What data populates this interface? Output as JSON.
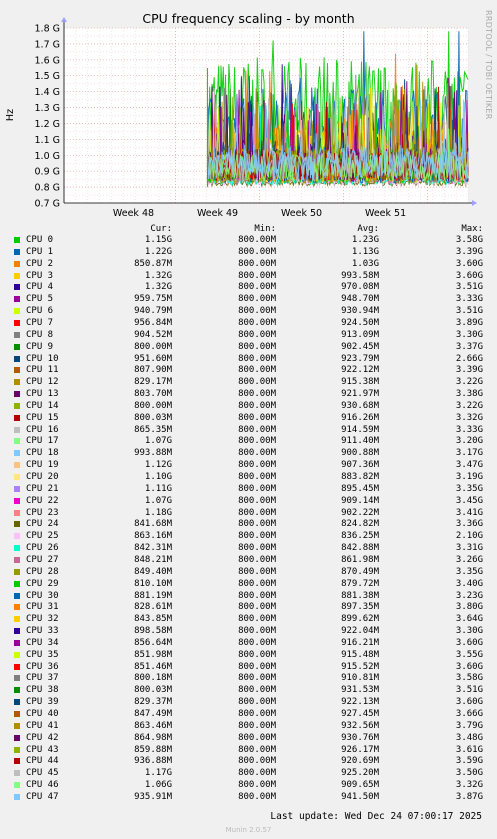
{
  "chart_data": {
    "type": "area",
    "title": "CPU frequency scaling - by month",
    "ylabel": "Hz",
    "y_ticks": [
      "0.7 G",
      "0.8 G",
      "0.9 G",
      "1.0 G",
      "1.1 G",
      "1.2 G",
      "1.3 G",
      "1.4 G",
      "1.5 G",
      "1.6 G",
      "1.7 G",
      "1.8 G"
    ],
    "ylim": [
      0.7,
      1.8
    ],
    "x_ticks": [
      "Week 48",
      "Week 49",
      "Week 50",
      "Week 51"
    ],
    "data_start_fraction": 0.355,
    "grid": true,
    "columns": [
      "Cur:",
      "Min:",
      "Avg:",
      "Max:"
    ],
    "series": [
      {
        "name": "CPU 0",
        "color": "#00cc00",
        "cur": "1.15G",
        "min": "800.00M",
        "avg": "1.23G",
        "max": "3.58G"
      },
      {
        "name": "CPU 1",
        "color": "#0066b3",
        "cur": "1.22G",
        "min": "800.00M",
        "avg": "1.13G",
        "max": "3.39G"
      },
      {
        "name": "CPU 2",
        "color": "#ff8000",
        "cur": "850.87M",
        "min": "800.00M",
        "avg": "1.03G",
        "max": "3.60G"
      },
      {
        "name": "CPU 3",
        "color": "#ffcc00",
        "cur": "1.32G",
        "min": "800.00M",
        "avg": "993.58M",
        "max": "3.60G"
      },
      {
        "name": "CPU 4",
        "color": "#330099",
        "cur": "1.32G",
        "min": "800.00M",
        "avg": "970.08M",
        "max": "3.51G"
      },
      {
        "name": "CPU 5",
        "color": "#990099",
        "cur": "959.75M",
        "min": "800.00M",
        "avg": "948.70M",
        "max": "3.33G"
      },
      {
        "name": "CPU 6",
        "color": "#ccff00",
        "cur": "940.79M",
        "min": "800.00M",
        "avg": "930.94M",
        "max": "3.51G"
      },
      {
        "name": "CPU 7",
        "color": "#ff0000",
        "cur": "956.84M",
        "min": "800.00M",
        "avg": "924.50M",
        "max": "3.89G"
      },
      {
        "name": "CPU 8",
        "color": "#808080",
        "cur": "904.52M",
        "min": "800.00M",
        "avg": "913.09M",
        "max": "3.30G"
      },
      {
        "name": "CPU 9",
        "color": "#008f00",
        "cur": "800.00M",
        "min": "800.00M",
        "avg": "902.45M",
        "max": "3.37G"
      },
      {
        "name": "CPU 10",
        "color": "#00487d",
        "cur": "951.60M",
        "min": "800.00M",
        "avg": "923.79M",
        "max": "2.66G"
      },
      {
        "name": "CPU 11",
        "color": "#b35a00",
        "cur": "807.90M",
        "min": "800.00M",
        "avg": "922.12M",
        "max": "3.39G"
      },
      {
        "name": "CPU 12",
        "color": "#b38f00",
        "cur": "829.17M",
        "min": "800.00M",
        "avg": "915.38M",
        "max": "3.22G"
      },
      {
        "name": "CPU 13",
        "color": "#6b006b",
        "cur": "803.70M",
        "min": "800.00M",
        "avg": "921.97M",
        "max": "3.38G"
      },
      {
        "name": "CPU 14",
        "color": "#8fb300",
        "cur": "800.00M",
        "min": "800.00M",
        "avg": "930.68M",
        "max": "3.22G"
      },
      {
        "name": "CPU 15",
        "color": "#b30000",
        "cur": "800.03M",
        "min": "800.00M",
        "avg": "916.26M",
        "max": "3.32G"
      },
      {
        "name": "CPU 16",
        "color": "#bebebe",
        "cur": "865.35M",
        "min": "800.00M",
        "avg": "914.59M",
        "max": "3.33G"
      },
      {
        "name": "CPU 17",
        "color": "#80ff80",
        "cur": "1.07G",
        "min": "800.00M",
        "avg": "911.40M",
        "max": "3.20G"
      },
      {
        "name": "CPU 18",
        "color": "#80c9ff",
        "cur": "993.88M",
        "min": "800.00M",
        "avg": "900.88M",
        "max": "3.17G"
      },
      {
        "name": "CPU 19",
        "color": "#ffc080",
        "cur": "1.12G",
        "min": "800.00M",
        "avg": "907.36M",
        "max": "3.47G"
      },
      {
        "name": "CPU 20",
        "color": "#ffe680",
        "cur": "1.10G",
        "min": "800.00M",
        "avg": "883.82M",
        "max": "3.19G"
      },
      {
        "name": "CPU 21",
        "color": "#aa80ff",
        "cur": "1.11G",
        "min": "800.00M",
        "avg": "895.45M",
        "max": "3.35G"
      },
      {
        "name": "CPU 22",
        "color": "#ee00cc",
        "cur": "1.07G",
        "min": "800.00M",
        "avg": "909.14M",
        "max": "3.45G"
      },
      {
        "name": "CPU 23",
        "color": "#ff8080",
        "cur": "1.18G",
        "min": "800.00M",
        "avg": "902.22M",
        "max": "3.41G"
      },
      {
        "name": "CPU 24",
        "color": "#666600",
        "cur": "841.68M",
        "min": "800.00M",
        "avg": "824.82M",
        "max": "3.36G"
      },
      {
        "name": "CPU 25",
        "color": "#ffbfff",
        "cur": "863.16M",
        "min": "800.00M",
        "avg": "836.25M",
        "max": "2.10G"
      },
      {
        "name": "CPU 26",
        "color": "#00ffcc",
        "cur": "842.31M",
        "min": "800.00M",
        "avg": "842.88M",
        "max": "3.31G"
      },
      {
        "name": "CPU 27",
        "color": "#cc6699",
        "cur": "848.21M",
        "min": "800.00M",
        "avg": "861.98M",
        "max": "3.26G"
      },
      {
        "name": "CPU 28",
        "color": "#999900",
        "cur": "849.40M",
        "min": "800.00M",
        "avg": "870.49M",
        "max": "3.35G"
      },
      {
        "name": "CPU 29",
        "color": "#00cc00",
        "cur": "810.10M",
        "min": "800.00M",
        "avg": "879.72M",
        "max": "3.40G"
      },
      {
        "name": "CPU 30",
        "color": "#0066b3",
        "cur": "881.19M",
        "min": "800.00M",
        "avg": "881.38M",
        "max": "3.23G"
      },
      {
        "name": "CPU 31",
        "color": "#ff8000",
        "cur": "828.61M",
        "min": "800.00M",
        "avg": "897.35M",
        "max": "3.80G"
      },
      {
        "name": "CPU 32",
        "color": "#ffcc00",
        "cur": "843.85M",
        "min": "800.00M",
        "avg": "899.62M",
        "max": "3.64G"
      },
      {
        "name": "CPU 33",
        "color": "#330099",
        "cur": "898.58M",
        "min": "800.00M",
        "avg": "922.04M",
        "max": "3.30G"
      },
      {
        "name": "CPU 34",
        "color": "#990099",
        "cur": "856.64M",
        "min": "800.00M",
        "avg": "916.21M",
        "max": "3.60G"
      },
      {
        "name": "CPU 35",
        "color": "#ccff00",
        "cur": "851.98M",
        "min": "800.00M",
        "avg": "915.48M",
        "max": "3.55G"
      },
      {
        "name": "CPU 36",
        "color": "#ff0000",
        "cur": "851.46M",
        "min": "800.00M",
        "avg": "915.52M",
        "max": "3.60G"
      },
      {
        "name": "CPU 37",
        "color": "#808080",
        "cur": "800.18M",
        "min": "800.00M",
        "avg": "910.81M",
        "max": "3.58G"
      },
      {
        "name": "CPU 38",
        "color": "#008f00",
        "cur": "800.03M",
        "min": "800.00M",
        "avg": "931.53M",
        "max": "3.51G"
      },
      {
        "name": "CPU 39",
        "color": "#00487d",
        "cur": "829.37M",
        "min": "800.00M",
        "avg": "922.13M",
        "max": "3.60G"
      },
      {
        "name": "CPU 40",
        "color": "#b35a00",
        "cur": "847.49M",
        "min": "800.00M",
        "avg": "927.45M",
        "max": "3.66G"
      },
      {
        "name": "CPU 41",
        "color": "#b38f00",
        "cur": "863.46M",
        "min": "800.00M",
        "avg": "932.56M",
        "max": "3.79G"
      },
      {
        "name": "CPU 42",
        "color": "#6b006b",
        "cur": "864.98M",
        "min": "800.00M",
        "avg": "930.76M",
        "max": "3.48G"
      },
      {
        "name": "CPU 43",
        "color": "#8fb300",
        "cur": "859.88M",
        "min": "800.00M",
        "avg": "926.17M",
        "max": "3.61G"
      },
      {
        "name": "CPU 44",
        "color": "#b30000",
        "cur": "936.88M",
        "min": "800.00M",
        "avg": "920.69M",
        "max": "3.59G"
      },
      {
        "name": "CPU 45",
        "color": "#bebebe",
        "cur": "1.17G",
        "min": "800.00M",
        "avg": "925.20M",
        "max": "3.50G"
      },
      {
        "name": "CPU 46",
        "color": "#80ff80",
        "cur": "1.06G",
        "min": "800.00M",
        "avg": "909.65M",
        "max": "3.32G"
      },
      {
        "name": "CPU 47",
        "color": "#80c9ff",
        "cur": "935.91M",
        "min": "800.00M",
        "avg": "941.50M",
        "max": "3.87G"
      }
    ]
  },
  "side_label": "RRDTOOL / TOBI OETIKER",
  "footer": "Last update: Wed Dec 24 07:00:17 2025",
  "generator": "Munin 2.0.57"
}
